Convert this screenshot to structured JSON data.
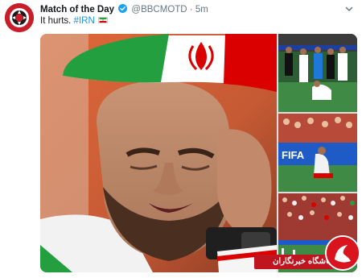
{
  "tweet": {
    "display_name": "Match of the Day",
    "handle": "@BBCMOTD",
    "separator": "·",
    "time": "5m",
    "text_prefix": "It hurts. ",
    "hashtag": "#IRN",
    "verified": true
  },
  "icons": {
    "verified": "verified-badge-icon",
    "more": "chevron-down-icon",
    "flag": "iran-flag-emoji"
  },
  "colors": {
    "link": "#1b95e0",
    "verified": "#1da1f2",
    "avatar_bg": "#c81d2a",
    "watermark": "#c0141f"
  },
  "watermark": {
    "text": "باشگاه خبرنگاران"
  }
}
